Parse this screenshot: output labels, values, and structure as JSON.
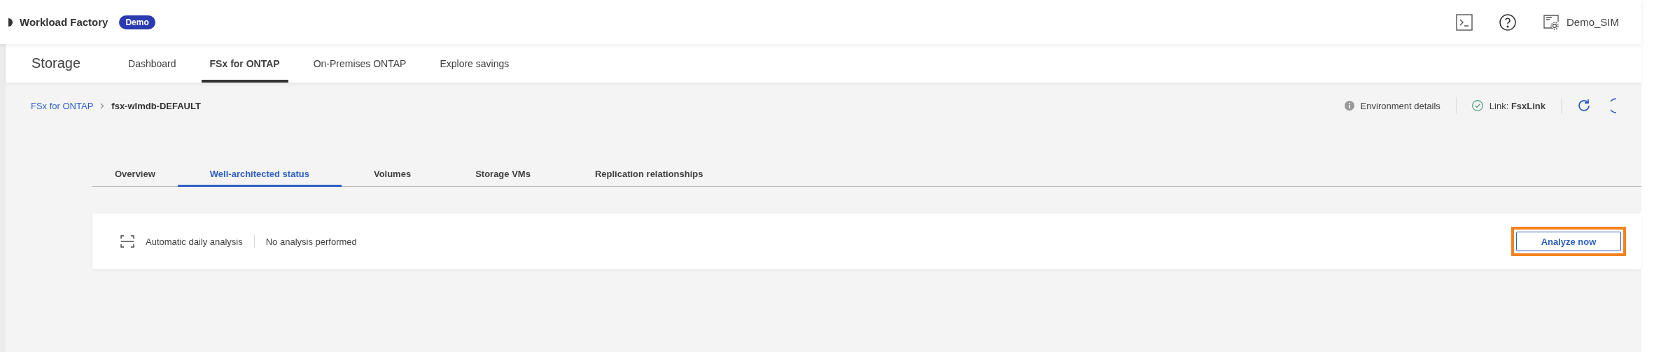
{
  "header": {
    "app_name": "Workload Factory",
    "badge": "Demo",
    "account": "Demo_SIM"
  },
  "nav": {
    "title": "Storage",
    "tabs": [
      {
        "label": "Dashboard",
        "selected": false
      },
      {
        "label": "FSx for ONTAP",
        "selected": true
      },
      {
        "label": "On-Premises ONTAP",
        "selected": false
      },
      {
        "label": "Explore savings",
        "selected": false
      }
    ]
  },
  "breadcrumb": {
    "items": [
      {
        "label": "FSx for ONTAP",
        "kind": "link"
      },
      {
        "label": "fsx-wlmdb-DEFAULT",
        "kind": "current"
      }
    ]
  },
  "toolbar": {
    "environment": "Environment details",
    "link_label": "Link:",
    "link_name": "FsxLink",
    "link_ok": true
  },
  "tabs": [
    {
      "label": "Overview",
      "selected": false
    },
    {
      "label": "Well-architected status",
      "selected": true
    },
    {
      "label": "Volumes",
      "selected": false
    },
    {
      "label": "Storage VMs",
      "selected": false
    },
    {
      "label": "Replication relationships",
      "selected": false
    }
  ],
  "analysis": {
    "schedule": "Automatic daily analysis",
    "status": "No analysis performed",
    "button": {
      "label": "Analyze now",
      "highlighted": true
    }
  }
}
